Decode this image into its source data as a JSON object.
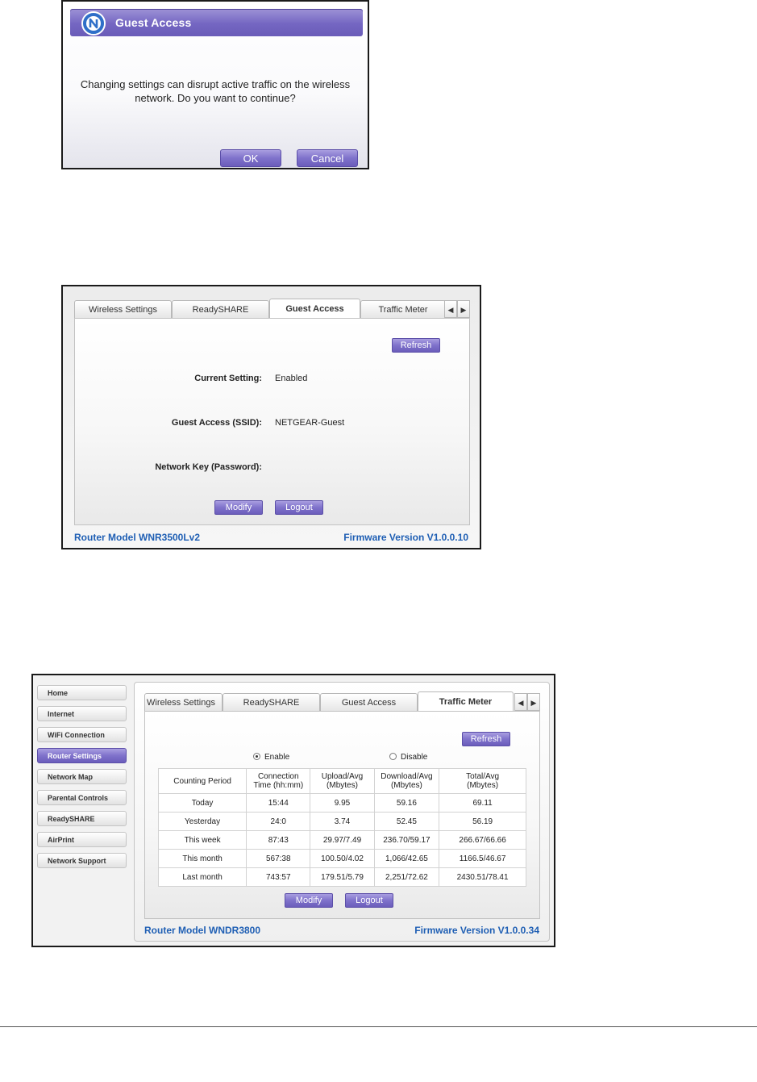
{
  "dialog": {
    "title": "Guest Access",
    "message": "Changing settings can disrupt active traffic on the wireless network. Do you want to continue?",
    "ok_label": "OK",
    "cancel_label": "Cancel",
    "logo_icon": "netgear-n-logo-icon"
  },
  "guest_panel": {
    "tabs": [
      "Wireless Settings",
      "ReadySHARE",
      "Guest Access",
      "Traffic Meter"
    ],
    "active_tab": "Guest Access",
    "refresh_label": "Refresh",
    "rows": [
      {
        "label": "Current Setting:",
        "value": "Enabled"
      },
      {
        "label": "Guest Access (SSID):",
        "value": "NETGEAR-Guest"
      },
      {
        "label": "Network Key (Password):",
        "value": ""
      }
    ],
    "modify_label": "Modify",
    "logout_label": "Logout",
    "router_model": "Router Model WNR3500Lv2",
    "firmware": "Firmware Version V1.0.0.10"
  },
  "traffic_panel": {
    "sidebar": [
      "Home",
      "Internet",
      "WiFi Connection",
      "Router Settings",
      "Network Map",
      "Parental Controls",
      "ReadySHARE",
      "AirPrint",
      "Network Support"
    ],
    "active_sidebar": "Router Settings",
    "tabs": [
      "Wireless Settings",
      "ReadySHARE",
      "Guest Access",
      "Traffic Meter"
    ],
    "active_tab": "Traffic Meter",
    "refresh_label": "Refresh",
    "enable_label": "Enable",
    "disable_label": "Disable",
    "selected": "Enable",
    "headers": [
      "Counting Period",
      "Connection Time  (hh:mm)",
      "Upload/Avg (Mbytes)",
      "Download/Avg (Mbytes)",
      "Total/Avg (Mbytes)"
    ],
    "header_lines": [
      [
        "Counting Period"
      ],
      [
        "Connection",
        "Time  (hh:mm)"
      ],
      [
        "Upload/Avg",
        "(Mbytes)"
      ],
      [
        "Download/Avg",
        "(Mbytes)"
      ],
      [
        "Total/Avg",
        "(Mbytes)"
      ]
    ],
    "rows": [
      [
        "Today",
        "15:44",
        "9.95",
        "59.16",
        "69.11"
      ],
      [
        "Yesterday",
        "24:0",
        "3.74",
        "52.45",
        "56.19"
      ],
      [
        "This week",
        "87:43",
        "29.97/7.49",
        "236.70/59.17",
        "266.67/66.66"
      ],
      [
        "This month",
        "567:38",
        "100.50/4.02",
        "1,066/42.65",
        "1166.5/46.67"
      ],
      [
        "Last month",
        "743:57",
        "179.51/5.79",
        "2,251/72.62",
        "2430.51/78.41"
      ]
    ],
    "modify_label": "Modify",
    "logout_label": "Logout",
    "router_model": "Router Model WNDR3800",
    "firmware": "Firmware Version V1.0.0.34"
  },
  "colors": {
    "accent": "#7b6ec8",
    "link": "#1f5fb4"
  }
}
